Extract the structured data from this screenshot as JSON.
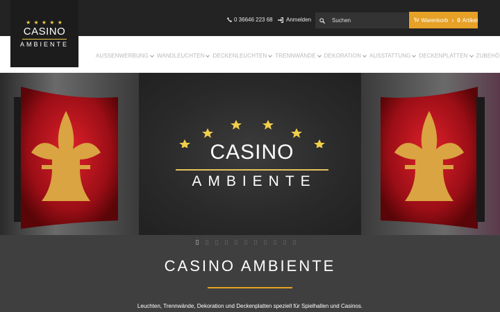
{
  "header": {
    "logo": {
      "stars": "★ ★ ★ ★ ★",
      "line1": "CASINO",
      "line2": "AMBIENTE"
    },
    "phone": {
      "icon": "phone-icon",
      "number": "0 36646 223 68"
    },
    "login": {
      "icon": "login-icon",
      "label": "Anmelden"
    },
    "search": {
      "icon": "search-icon",
      "placeholder": "Suchen"
    },
    "cart": {
      "icon": "cart-icon",
      "label": "Warenkorb",
      "count": "0",
      "count_label": "Artikel",
      "color": "#e6a126"
    }
  },
  "nav": {
    "items": [
      {
        "label": "AUSSENWERBUNG"
      },
      {
        "label": "WANDLEUCHTEN"
      },
      {
        "label": "DECKENLEUCHTEN"
      },
      {
        "label": "TRENNWÄNDE"
      },
      {
        "label": "DEKORATION"
      },
      {
        "label": "AUSSTATTUNG"
      },
      {
        "label": "DECKENPLATTEN"
      },
      {
        "label": "ZUBEHÖR"
      }
    ]
  },
  "hero": {
    "title": "CASINO",
    "subtitle": "AMBIENTE",
    "slides": 11,
    "active_slide": 1
  },
  "intro": {
    "title": "CASINO AMBIENTE",
    "text": "Leuchten, Trennwände, Dekoration und Deckenplatten speziell für Spielhallen und Casinos.",
    "accent": "#e6a126"
  }
}
